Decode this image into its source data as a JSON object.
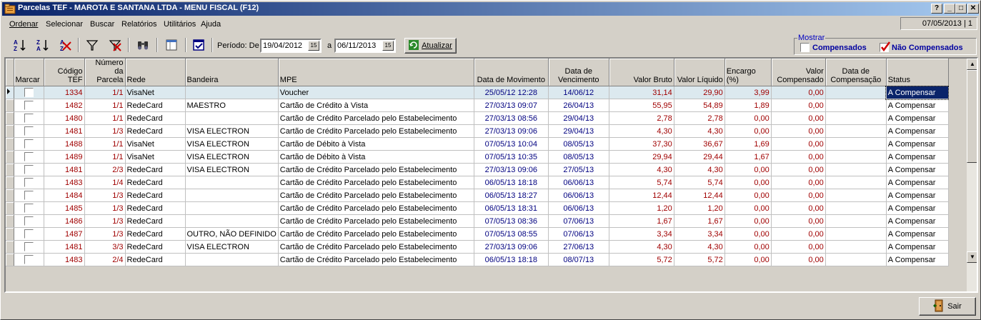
{
  "window": {
    "title": "Parcelas TEF - MAROTA E SANTANA LTDA - MENU FISCAL (F12)",
    "controls": [
      "?",
      "_",
      "□",
      "✕"
    ]
  },
  "menu": {
    "items": [
      "Ordenar",
      "Selecionar",
      "Buscar",
      "Relatórios",
      "Utilitários",
      "Ajuda"
    ]
  },
  "status_date": "07/05/2013 | 1",
  "toolbar": {
    "periodo_label": "Período: De",
    "date_from": "19/04/2012",
    "a_label": "a",
    "date_to": "06/11/2013",
    "atualizar_label": "Atualizar",
    "calendar_glyph": "15"
  },
  "mostrar": {
    "legend": "Mostrar",
    "compensados_label": "Compensados",
    "compensados_checked": false,
    "nao_compensados_label": "Não Compensados",
    "nao_compensados_checked": true
  },
  "grid": {
    "headers": [
      "Marcar",
      "Código TEF",
      "Número da Parcela",
      "Rede",
      "Bandeira",
      "MPE",
      "Data de Movimento",
      "Data de Vencimento",
      "Valor Bruto",
      "Valor Líquido",
      "Encargo (%)",
      "Valor Compensado",
      "Data de Compensação",
      "Status"
    ],
    "rows": [
      {
        "codigo": "1334",
        "parcela": "1/1",
        "rede": "VisaNet",
        "bandeira": "",
        "mpe": "Voucher",
        "movimento": "25/05/12 12:28",
        "vencimento": "14/06/12",
        "bruto": "31,14",
        "liquido": "29,90",
        "encargo": "3,99",
        "compensado": "0,00",
        "data_comp": "",
        "status": "A Compensar"
      },
      {
        "codigo": "1482",
        "parcela": "1/1",
        "rede": "RedeCard",
        "bandeira": "MAESTRO",
        "mpe": "Cartão de Crédito à Vista",
        "movimento": "27/03/13 09:07",
        "vencimento": "26/04/13",
        "bruto": "55,95",
        "liquido": "54,89",
        "encargo": "1,89",
        "compensado": "0,00",
        "data_comp": "",
        "status": "A Compensar"
      },
      {
        "codigo": "1480",
        "parcela": "1/1",
        "rede": "RedeCard",
        "bandeira": "",
        "mpe": "Cartão de Crédito Parcelado pelo Estabelecimento",
        "movimento": "27/03/13 08:56",
        "vencimento": "29/04/13",
        "bruto": "2,78",
        "liquido": "2,78",
        "encargo": "0,00",
        "compensado": "0,00",
        "data_comp": "",
        "status": "A Compensar"
      },
      {
        "codigo": "1481",
        "parcela": "1/3",
        "rede": "RedeCard",
        "bandeira": "VISA ELECTRON",
        "mpe": "Cartão de Crédito Parcelado pelo Estabelecimento",
        "movimento": "27/03/13 09:06",
        "vencimento": "29/04/13",
        "bruto": "4,30",
        "liquido": "4,30",
        "encargo": "0,00",
        "compensado": "0,00",
        "data_comp": "",
        "status": "A Compensar"
      },
      {
        "codigo": "1488",
        "parcela": "1/1",
        "rede": "VisaNet",
        "bandeira": "VISA ELECTRON",
        "mpe": "Cartão de Débito à Vista",
        "movimento": "07/05/13 10:04",
        "vencimento": "08/05/13",
        "bruto": "37,30",
        "liquido": "36,67",
        "encargo": "1,69",
        "compensado": "0,00",
        "data_comp": "",
        "status": "A Compensar"
      },
      {
        "codigo": "1489",
        "parcela": "1/1",
        "rede": "VisaNet",
        "bandeira": "VISA ELECTRON",
        "mpe": "Cartão de Débito à Vista",
        "movimento": "07/05/13 10:35",
        "vencimento": "08/05/13",
        "bruto": "29,94",
        "liquido": "29,44",
        "encargo": "1,67",
        "compensado": "0,00",
        "data_comp": "",
        "status": "A Compensar"
      },
      {
        "codigo": "1481",
        "parcela": "2/3",
        "rede": "RedeCard",
        "bandeira": "VISA ELECTRON",
        "mpe": "Cartão de Crédito Parcelado pelo Estabelecimento",
        "movimento": "27/03/13 09:06",
        "vencimento": "27/05/13",
        "bruto": "4,30",
        "liquido": "4,30",
        "encargo": "0,00",
        "compensado": "0,00",
        "data_comp": "",
        "status": "A Compensar"
      },
      {
        "codigo": "1483",
        "parcela": "1/4",
        "rede": "RedeCard",
        "bandeira": "",
        "mpe": "Cartão de Crédito Parcelado pelo Estabelecimento",
        "movimento": "06/05/13 18:18",
        "vencimento": "06/06/13",
        "bruto": "5,74",
        "liquido": "5,74",
        "encargo": "0,00",
        "compensado": "0,00",
        "data_comp": "",
        "status": "A Compensar"
      },
      {
        "codigo": "1484",
        "parcela": "1/3",
        "rede": "RedeCard",
        "bandeira": "",
        "mpe": "Cartão de Crédito Parcelado pelo Estabelecimento",
        "movimento": "06/05/13 18:27",
        "vencimento": "06/06/13",
        "bruto": "12,44",
        "liquido": "12,44",
        "encargo": "0,00",
        "compensado": "0,00",
        "data_comp": "",
        "status": "A Compensar"
      },
      {
        "codigo": "1485",
        "parcela": "1/3",
        "rede": "RedeCard",
        "bandeira": "",
        "mpe": "Cartão de Crédito Parcelado pelo Estabelecimento",
        "movimento": "06/05/13 18:31",
        "vencimento": "06/06/13",
        "bruto": "1,20",
        "liquido": "1,20",
        "encargo": "0,00",
        "compensado": "0,00",
        "data_comp": "",
        "status": "A Compensar"
      },
      {
        "codigo": "1486",
        "parcela": "1/3",
        "rede": "RedeCard",
        "bandeira": "",
        "mpe": "Cartão de Crédito Parcelado pelo Estabelecimento",
        "movimento": "07/05/13 08:36",
        "vencimento": "07/06/13",
        "bruto": "1,67",
        "liquido": "1,67",
        "encargo": "0,00",
        "compensado": "0,00",
        "data_comp": "",
        "status": "A Compensar"
      },
      {
        "codigo": "1487",
        "parcela": "1/3",
        "rede": "RedeCard",
        "bandeira": "OUTRO, NÃO DEFINIDO",
        "mpe": "Cartão de Crédito Parcelado pelo Estabelecimento",
        "movimento": "07/05/13 08:55",
        "vencimento": "07/06/13",
        "bruto": "3,34",
        "liquido": "3,34",
        "encargo": "0,00",
        "compensado": "0,00",
        "data_comp": "",
        "status": "A Compensar"
      },
      {
        "codigo": "1481",
        "parcela": "3/3",
        "rede": "RedeCard",
        "bandeira": "VISA ELECTRON",
        "mpe": "Cartão de Crédito Parcelado pelo Estabelecimento",
        "movimento": "27/03/13 09:06",
        "vencimento": "27/06/13",
        "bruto": "4,30",
        "liquido": "4,30",
        "encargo": "0,00",
        "compensado": "0,00",
        "data_comp": "",
        "status": "A Compensar"
      },
      {
        "codigo": "1483",
        "parcela": "2/4",
        "rede": "RedeCard",
        "bandeira": "",
        "mpe": "Cartão de Crédito Parcelado pelo Estabelecimento",
        "movimento": "06/05/13 18:18",
        "vencimento": "08/07/13",
        "bruto": "5,72",
        "liquido": "5,72",
        "encargo": "0,00",
        "compensado": "0,00",
        "data_comp": "",
        "status": "A Compensar"
      }
    ]
  },
  "footer": {
    "sair_label": "Sair"
  },
  "colors": {
    "title_gradient_start": "#0a246a",
    "title_gradient_end": "#a6caf0",
    "code_red": "#a00000",
    "date_blue": "#000080",
    "selected_row": "#dce9ef"
  }
}
